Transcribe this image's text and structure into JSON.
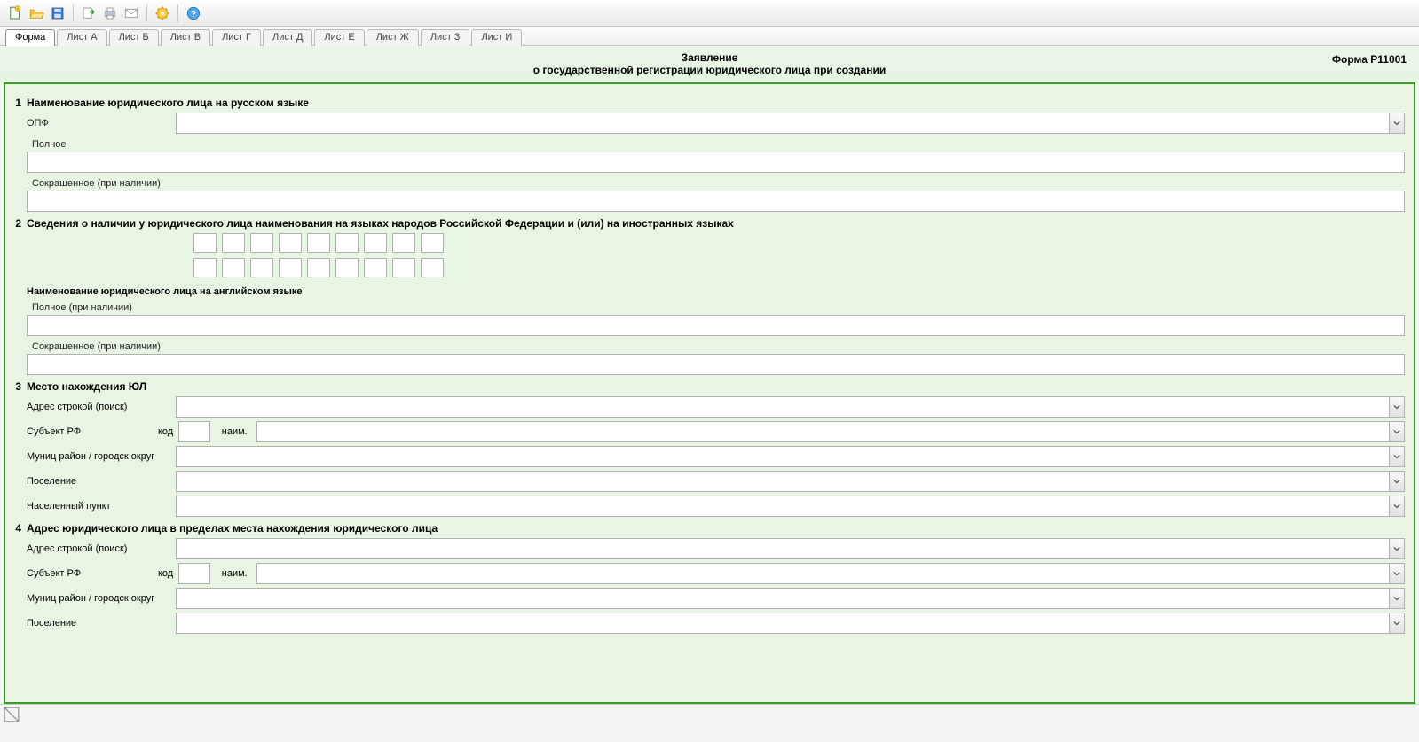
{
  "toolbar": {
    "icons": [
      "new",
      "open",
      "save",
      "export",
      "print",
      "mail",
      "settings",
      "help"
    ]
  },
  "tabs": [
    {
      "label": "Форма",
      "active": true
    },
    {
      "label": "Лист А",
      "active": false
    },
    {
      "label": "Лист Б",
      "active": false
    },
    {
      "label": "Лист В",
      "active": false
    },
    {
      "label": "Лист Г",
      "active": false
    },
    {
      "label": "Лист Д",
      "active": false
    },
    {
      "label": "Лист Е",
      "active": false
    },
    {
      "label": "Лист Ж",
      "active": false
    },
    {
      "label": "Лист З",
      "active": false
    },
    {
      "label": "Лист И",
      "active": false
    }
  ],
  "header": {
    "line1": "Заявление",
    "line2": "о государственной регистрации юридического лица при создании",
    "form_code": "Форма Р11001"
  },
  "sections": {
    "s1": {
      "num": "1",
      "title": "Наименование юридического лица на русском языке",
      "opf_label": "ОПФ",
      "opf_value": "",
      "full_label": "Полное",
      "full_value": "",
      "short_label": "Сокращенное (при наличии)",
      "short_value": ""
    },
    "s2": {
      "num": "2",
      "title": "Сведения о наличии у юридического лица наименования на языках народов Российской Федерации и (или) на иностранных языках",
      "eng_title": "Наименование юридического лица на английском языке",
      "eng_full_label": "Полное (при наличии)",
      "eng_full_value": "",
      "eng_short_label": "Сокращенное (при наличии)",
      "eng_short_value": ""
    },
    "s3": {
      "num": "3",
      "title": "Место нахождения ЮЛ",
      "addr_search_label": "Адрес строкой (поиск)",
      "addr_search_value": "",
      "subject_label": "Субъект РФ",
      "code_label": "код",
      "code_value": "",
      "naim_label": "наим.",
      "naim_value": "",
      "munic_label": "Муниц район / городск округ",
      "munic_value": "",
      "settlement_label": "Поселение",
      "settlement_value": "",
      "locality_label": "Населенный пункт",
      "locality_value": ""
    },
    "s4": {
      "num": "4",
      "title": "Адрес юридического лица в пределах места нахождения юридического лица",
      "addr_search_label": "Адрес строкой (поиск)",
      "addr_search_value": "",
      "subject_label": "Субъект РФ",
      "code_label": "код",
      "code_value": "",
      "naim_label": "наим.",
      "naim_value": "",
      "munic_label": "Муниц район / городск округ",
      "munic_value": "",
      "settlement_label": "Поселение",
      "settlement_value": ""
    }
  }
}
